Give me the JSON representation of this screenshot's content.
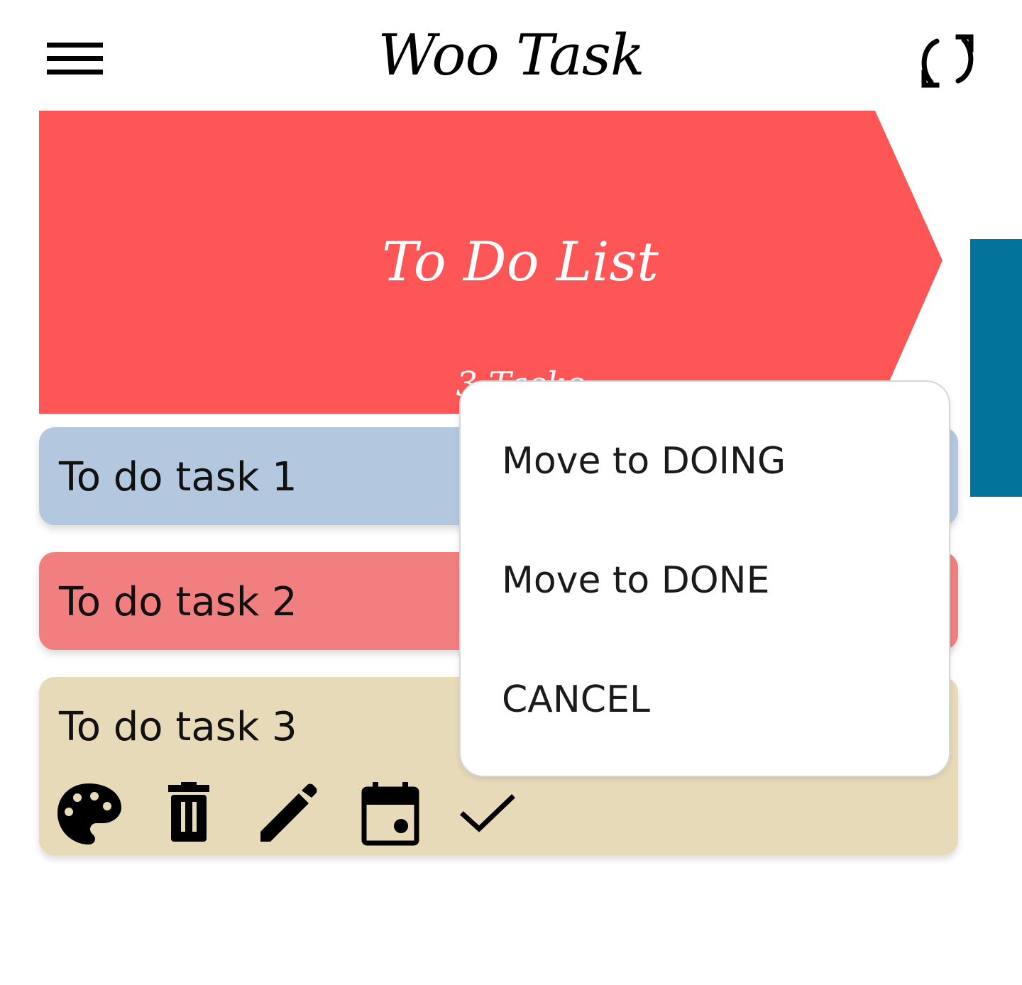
{
  "app": {
    "title": "Woo Task"
  },
  "header": {
    "menu_icon": "hamburger-menu-icon",
    "refresh_icon": "sync-icon"
  },
  "column": {
    "title": "To Do List",
    "count_label": "3 Tasks",
    "color": "#fe5656",
    "next_column_color": "#02749c"
  },
  "tasks": [
    {
      "label": "To do task 1",
      "color": "#b3c8df"
    },
    {
      "label": "To do task 2",
      "color": "#f27f7f"
    },
    {
      "label": "To do task 3",
      "color": "#e6dab9"
    }
  ],
  "task_actions": [
    {
      "name": "palette-icon"
    },
    {
      "name": "trash-icon"
    },
    {
      "name": "pencil-icon"
    },
    {
      "name": "calendar-icon"
    },
    {
      "name": "check-icon"
    }
  ],
  "popup_menu": {
    "items": [
      {
        "label": "Move to DOING"
      },
      {
        "label": "Move to DONE"
      },
      {
        "label": "CANCEL"
      }
    ]
  }
}
